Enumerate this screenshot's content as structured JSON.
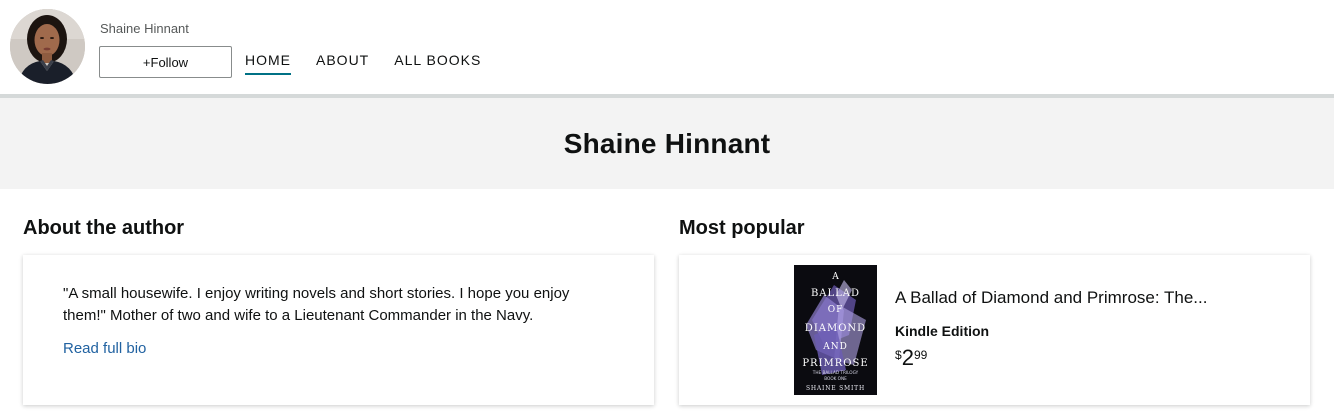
{
  "header": {
    "author_name_small": "Shaine Hinnant",
    "follow_label": "+Follow",
    "nav": [
      {
        "label": "HOME",
        "active": true
      },
      {
        "label": "ABOUT",
        "active": false
      },
      {
        "label": "ALL BOOKS",
        "active": false
      }
    ]
  },
  "banner": {
    "title": "Shaine Hinnant"
  },
  "about": {
    "heading": "About the author",
    "bio": "\"A small housewife. I enjoy writing novels and short stories. I hope you enjoy them!\" Mother of two and wife to a Lieutenant Commander in the Navy.",
    "read_more": "Read full bio"
  },
  "popular": {
    "heading": "Most popular",
    "book": {
      "title": "A Ballad of Diamond and Primrose: The...",
      "format": "Kindle Edition",
      "price_symbol": "$",
      "price_whole": "2",
      "price_fraction": "99",
      "cover_lines": [
        "A",
        "BALLAD",
        "OF",
        "DIAMOND",
        "AND",
        "PRIMROSE"
      ],
      "cover_subtitle": "THE BALLAD TRILOGY",
      "cover_subtitle2": "BOOK ONE",
      "cover_author": "SHAINE SMITH"
    }
  },
  "colors": {
    "accent_underline": "#007185",
    "link": "#2162a1",
    "banner_bg": "#f3f3f3"
  }
}
